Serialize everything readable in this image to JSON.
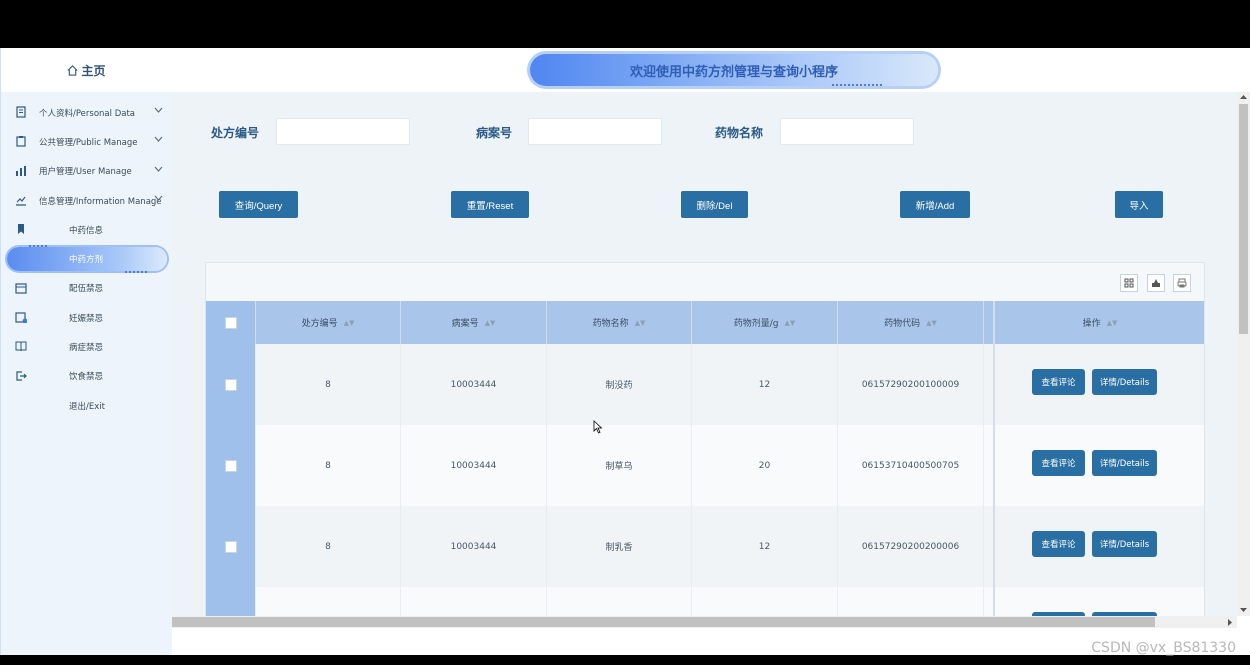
{
  "sidebar": {
    "home_label": "主页",
    "items": [
      {
        "label": "个人资料/Personal Data",
        "icon": "document-icon",
        "expand": true
      },
      {
        "label": "公共管理/Public Manage",
        "icon": "clipboard-icon",
        "expand": true
      },
      {
        "label": "用户管理/User Manage",
        "icon": "chart-bars-icon",
        "expand": true
      },
      {
        "label": "信息管理/Information Manage",
        "icon": "chart-line-icon",
        "expand": true
      },
      {
        "label": "中药信息",
        "icon": "bookmark-icon",
        "sub": true
      },
      {
        "label": "中药方剂",
        "icon": "",
        "sub": true,
        "active": true
      },
      {
        "label": "配伍禁忌",
        "icon": "calendar-icon",
        "sub": true
      },
      {
        "label": "妊娠禁忌",
        "icon": "calendar-check-icon",
        "sub": true
      },
      {
        "label": "病症禁忌",
        "icon": "book-icon",
        "sub": true
      },
      {
        "label": "饮食禁忌",
        "icon": "logout-icon",
        "sub": true
      },
      {
        "label": "退出/Exit",
        "icon": "",
        "sub": true
      }
    ]
  },
  "header": {
    "banner": "欢迎使用中药方剂管理与查询小程序"
  },
  "filters": {
    "f1": "处方编号",
    "f2": "病案号",
    "f3": "药物名称"
  },
  "actions": {
    "query": "查询/Query",
    "reset": "重置/Reset",
    "del": "删除/Del",
    "add": "新增/Add",
    "import": "导入"
  },
  "table": {
    "headers": [
      "处方编号",
      "病案号",
      "药物名称",
      "药物剂量/g",
      "药物代码",
      "操作"
    ],
    "rows": [
      {
        "c1": "8",
        "c2": "10003444",
        "c3": "制没药",
        "c4": "12",
        "c5": "06157290200100009"
      },
      {
        "c1": "8",
        "c2": "10003444",
        "c3": "制草乌",
        "c4": "20",
        "c5": "06153710400500705"
      },
      {
        "c1": "8",
        "c2": "10003444",
        "c3": "制乳香",
        "c4": "12",
        "c5": "06157290200200006"
      }
    ],
    "op_comment": "查看评论",
    "op_details": "详情/Details"
  },
  "watermark": "CSDN @vx_BS81330"
}
